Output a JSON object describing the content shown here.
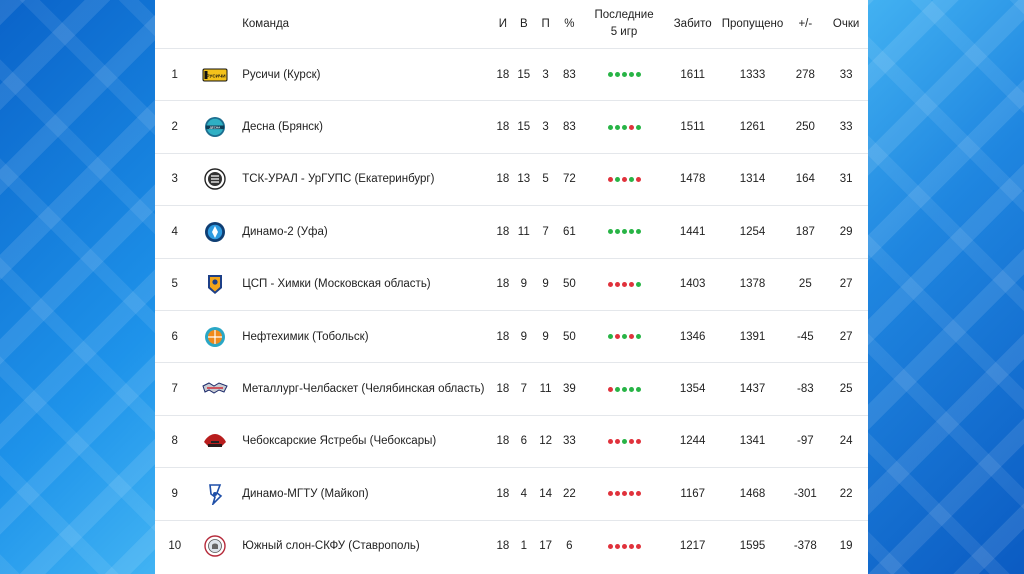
{
  "colors": {
    "win": "#28b446",
    "loss": "#e0323c"
  },
  "header": {
    "team": "Команда",
    "games": "И",
    "wins": "В",
    "losses": "П",
    "pct": "%",
    "last_line1": "Последние",
    "last_line2": "5 игр",
    "scored": "Забито",
    "conceded": "Пропущено",
    "diff": "+/-",
    "points": "Очки"
  },
  "rows": [
    {
      "pos": "1",
      "team": "Русичи (Курск)",
      "games": "18",
      "wins": "15",
      "losses": "3",
      "pct": "83",
      "last5": [
        "W",
        "W",
        "W",
        "W",
        "W"
      ],
      "scored": "1611",
      "conceded": "1333",
      "diff": "278",
      "points": "33",
      "logo_text": "РУСИЧИ",
      "logo_icon": "rusichi-logo"
    },
    {
      "pos": "2",
      "team": "Десна (Брянск)",
      "games": "18",
      "wins": "15",
      "losses": "3",
      "pct": "83",
      "last5": [
        "W",
        "W",
        "W",
        "L",
        "W"
      ],
      "scored": "1511",
      "conceded": "1261",
      "diff": "250",
      "points": "33",
      "logo_text": "ДЕСНА",
      "logo_icon": "desna-logo"
    },
    {
      "pos": "3",
      "team": "ТСК-УРАЛ - УрГУПС (Екатеринбург)",
      "games": "18",
      "wins": "13",
      "losses": "5",
      "pct": "72",
      "last5": [
        "L",
        "W",
        "L",
        "W",
        "L"
      ],
      "scored": "1478",
      "conceded": "1314",
      "diff": "164",
      "points": "31",
      "logo_text": "",
      "logo_icon": "tsk-ural-logo"
    },
    {
      "pos": "4",
      "team": "Динамо-2 (Уфа)",
      "games": "18",
      "wins": "11",
      "losses": "7",
      "pct": "61",
      "last5": [
        "W",
        "W",
        "W",
        "W",
        "W"
      ],
      "scored": "1441",
      "conceded": "1254",
      "diff": "187",
      "points": "29",
      "logo_text": "",
      "logo_icon": "dinamo-ufa-logo"
    },
    {
      "pos": "5",
      "team": "ЦСП - Химки (Московская область)",
      "games": "18",
      "wins": "9",
      "losses": "9",
      "pct": "50",
      "last5": [
        "L",
        "L",
        "L",
        "L",
        "W"
      ],
      "scored": "1403",
      "conceded": "1378",
      "diff": "25",
      "points": "27",
      "logo_text": "",
      "logo_icon": "csp-khimki-logo"
    },
    {
      "pos": "6",
      "team": "Нефтехимик (Тобольск)",
      "games": "18",
      "wins": "9",
      "losses": "9",
      "pct": "50",
      "last5": [
        "W",
        "L",
        "W",
        "L",
        "W"
      ],
      "scored": "1346",
      "conceded": "1391",
      "diff": "-45",
      "points": "27",
      "logo_text": "",
      "logo_icon": "neftekhimik-logo"
    },
    {
      "pos": "7",
      "team": "Металлург-Челбаскет (Челябинская область)",
      "games": "18",
      "wins": "7",
      "losses": "11",
      "pct": "39",
      "last5": [
        "L",
        "W",
        "W",
        "W",
        "W"
      ],
      "scored": "1354",
      "conceded": "1437",
      "diff": "-83",
      "points": "25",
      "logo_text": "",
      "logo_icon": "metallurg-logo"
    },
    {
      "pos": "8",
      "team": "Чебоксарские Ястребы (Чебоксары)",
      "games": "18",
      "wins": "6",
      "losses": "12",
      "pct": "33",
      "last5": [
        "L",
        "L",
        "W",
        "L",
        "L"
      ],
      "scored": "1244",
      "conceded": "1341",
      "diff": "-97",
      "points": "24",
      "logo_text": "",
      "logo_icon": "cheboksary-logo"
    },
    {
      "pos": "9",
      "team": "Динамо-МГТУ (Майкоп)",
      "games": "18",
      "wins": "4",
      "losses": "14",
      "pct": "22",
      "last5": [
        "L",
        "L",
        "L",
        "L",
        "L"
      ],
      "scored": "1167",
      "conceded": "1468",
      "diff": "-301",
      "points": "22",
      "logo_text": "",
      "logo_icon": "dinamo-maykop-logo"
    },
    {
      "pos": "10",
      "team": "Южный слон-СКФУ (Ставрополь)",
      "games": "18",
      "wins": "1",
      "losses": "17",
      "pct": "6",
      "last5": [
        "L",
        "L",
        "L",
        "L",
        "L"
      ],
      "scored": "1217",
      "conceded": "1595",
      "diff": "-378",
      "points": "19",
      "logo_text": "",
      "logo_icon": "yuzhny-slon-logo"
    }
  ]
}
